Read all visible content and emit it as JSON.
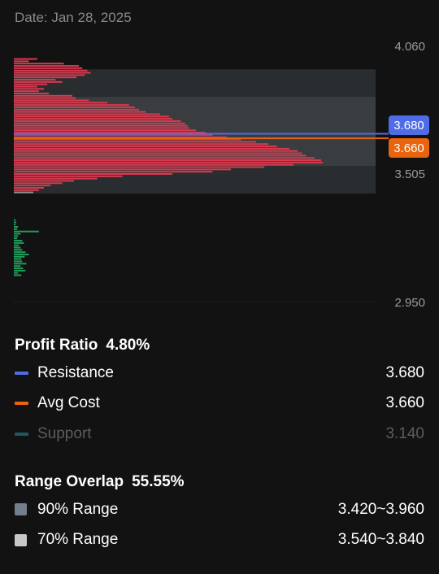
{
  "header": {
    "date": "Date: Jan 28, 2025"
  },
  "chart_data": {
    "type": "bar",
    "orientation": "horizontal",
    "ylim": [
      2.95,
      4.06
    ],
    "y_ticks": [
      "4.060",
      "3.505",
      "2.950"
    ],
    "markers": [
      {
        "name": "Resistance",
        "value": 3.68,
        "label": "3.680",
        "color": "#4f6ce6"
      },
      {
        "name": "Avg Cost",
        "value": 3.66,
        "label": "3.660",
        "color": "#e8640f"
      }
    ],
    "bands": [
      {
        "name": "90% Range",
        "from": 3.42,
        "to": 3.96,
        "color": "#2a2d30"
      },
      {
        "name": "70% Range",
        "from": 3.54,
        "to": 3.84,
        "color": "#3a3d40"
      }
    ],
    "profit_series": {
      "color": "#d83a4f",
      "y": [
        4.005,
        3.995,
        3.985,
        3.975,
        3.965,
        3.955,
        3.945,
        3.935,
        3.925,
        3.915,
        3.905,
        3.895,
        3.885,
        3.875,
        3.865,
        3.855,
        3.845,
        3.835,
        3.825,
        3.815,
        3.805,
        3.795,
        3.785,
        3.775,
        3.765,
        3.755,
        3.745,
        3.735,
        3.725,
        3.715,
        3.705,
        3.695,
        3.685,
        3.675,
        3.665,
        3.655,
        3.645,
        3.635,
        3.625,
        3.615,
        3.605,
        3.595,
        3.585,
        3.575,
        3.565,
        3.555,
        3.545,
        3.535,
        3.525,
        3.515,
        3.505,
        3.495,
        3.485,
        3.475,
        3.465,
        3.455,
        3.445,
        3.435
      ],
      "values": [
        28,
        18,
        60,
        78,
        82,
        88,
        92,
        85,
        75,
        50,
        58,
        40,
        28,
        36,
        30,
        42,
        70,
        74,
        90,
        112,
        138,
        145,
        150,
        158,
        175,
        186,
        190,
        200,
        205,
        208,
        210,
        218,
        230,
        238,
        255,
        272,
        290,
        305,
        315,
        330,
        340,
        345,
        350,
        360,
        368,
        370,
        335,
        300,
        260,
        238,
        190,
        130,
        100,
        72,
        58,
        44,
        36,
        30
      ]
    },
    "loss_series": {
      "color": "#1f9d5a",
      "y": [
        3.305,
        3.295,
        3.285,
        3.275,
        3.265,
        3.255,
        3.245,
        3.235,
        3.225,
        3.215,
        3.205,
        3.195,
        3.185,
        3.175,
        3.165,
        3.155,
        3.145,
        3.135,
        3.125,
        3.115,
        3.105,
        3.095,
        3.085,
        3.075,
        3.065
      ],
      "values": [
        2,
        3,
        2,
        5,
        4,
        30,
        8,
        5,
        4,
        10,
        12,
        6,
        8,
        10,
        14,
        18,
        13,
        9,
        10,
        15,
        8,
        11,
        14,
        5,
        9
      ]
    }
  },
  "profit": {
    "label": "Profit Ratio",
    "value": "4.80%",
    "rows": [
      {
        "label": "Resistance",
        "value": "3.680",
        "color": "#4f6ce6"
      },
      {
        "label": "Avg Cost",
        "value": "3.660",
        "color": "#e8640f"
      },
      {
        "label": "Support",
        "value": "3.140",
        "color": "#1e5960"
      }
    ]
  },
  "overlap": {
    "label": "Range Overlap",
    "value": "55.55%",
    "rows": [
      {
        "label": "90% Range",
        "value": "3.420~3.960",
        "color": "#737f8c"
      },
      {
        "label": "70% Range",
        "value": "3.540~3.840",
        "color": "#c7c7c7"
      }
    ]
  }
}
